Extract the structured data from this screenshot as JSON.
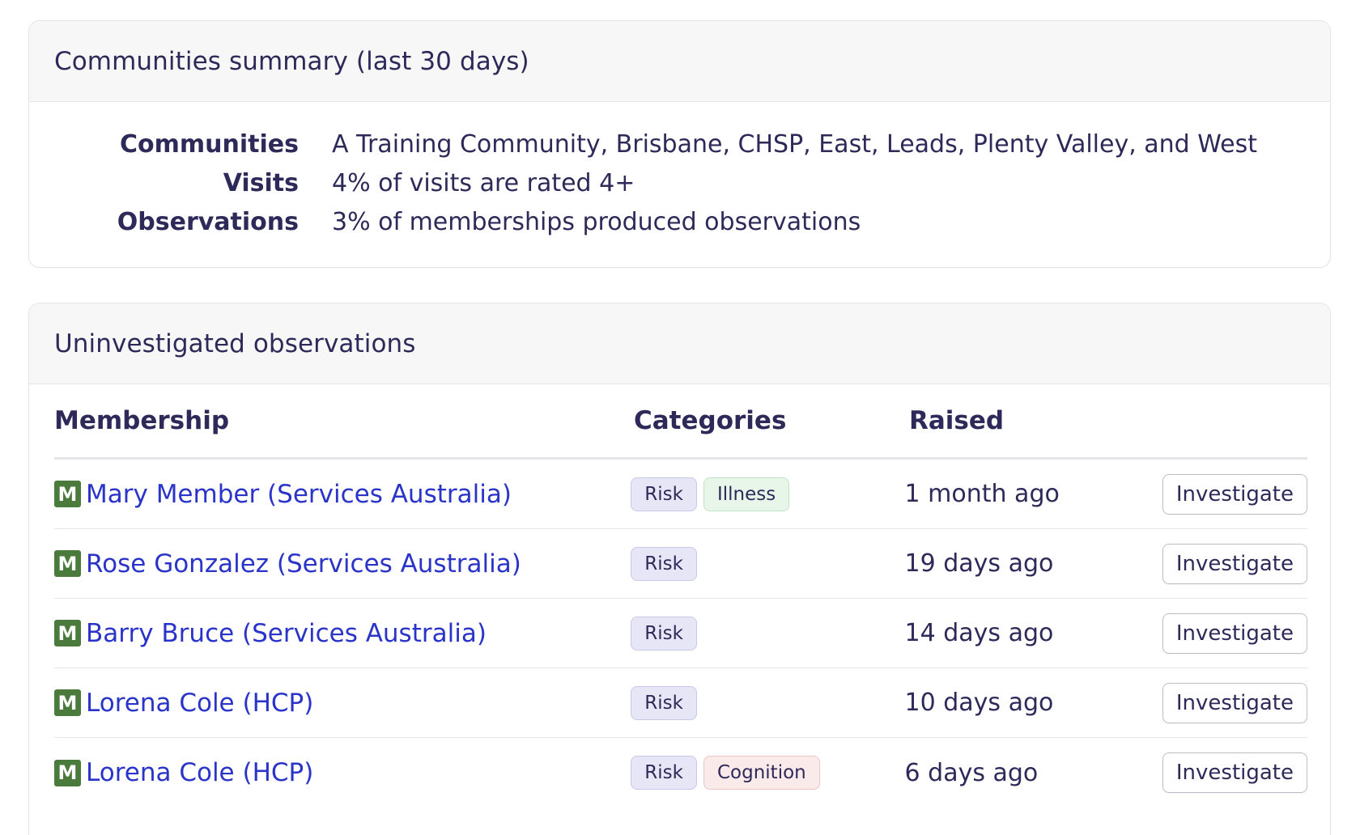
{
  "summary": {
    "title": "Communities summary (last 30 days)",
    "rows": [
      {
        "label": "Communities",
        "value": "A Training Community, Brisbane, CHSP, East, Leads, Plenty Valley, and West"
      },
      {
        "label": "Visits",
        "value": "4% of visits are rated 4+"
      },
      {
        "label": "Observations",
        "value": "3% of memberships produced observations"
      }
    ]
  },
  "observations": {
    "title": "Uninvestigated observations",
    "columns": {
      "membership": "Membership",
      "categories": "Categories",
      "raised": "Raised"
    },
    "badge_letter": "M",
    "action_label": "Investigate",
    "rows": [
      {
        "member": "Mary Member (Services Australia)",
        "categories": [
          "Risk",
          "Illness"
        ],
        "raised": "1 month ago"
      },
      {
        "member": "Rose Gonzalez (Services Australia)",
        "categories": [
          "Risk"
        ],
        "raised": "19 days ago"
      },
      {
        "member": "Barry Bruce (Services Australia)",
        "categories": [
          "Risk"
        ],
        "raised": "14 days ago"
      },
      {
        "member": "Lorena Cole (HCP)",
        "categories": [
          "Risk"
        ],
        "raised": "10 days ago"
      },
      {
        "member": "Lorena Cole (HCP)",
        "categories": [
          "Risk",
          "Cognition"
        ],
        "raised": "6 days ago"
      }
    ]
  },
  "colors": {
    "text": "#2d2a5a",
    "link": "#2a34c8",
    "badge": "#4a7a3c",
    "header_bg": "#f7f7f7",
    "border": "#e4e4e9"
  }
}
